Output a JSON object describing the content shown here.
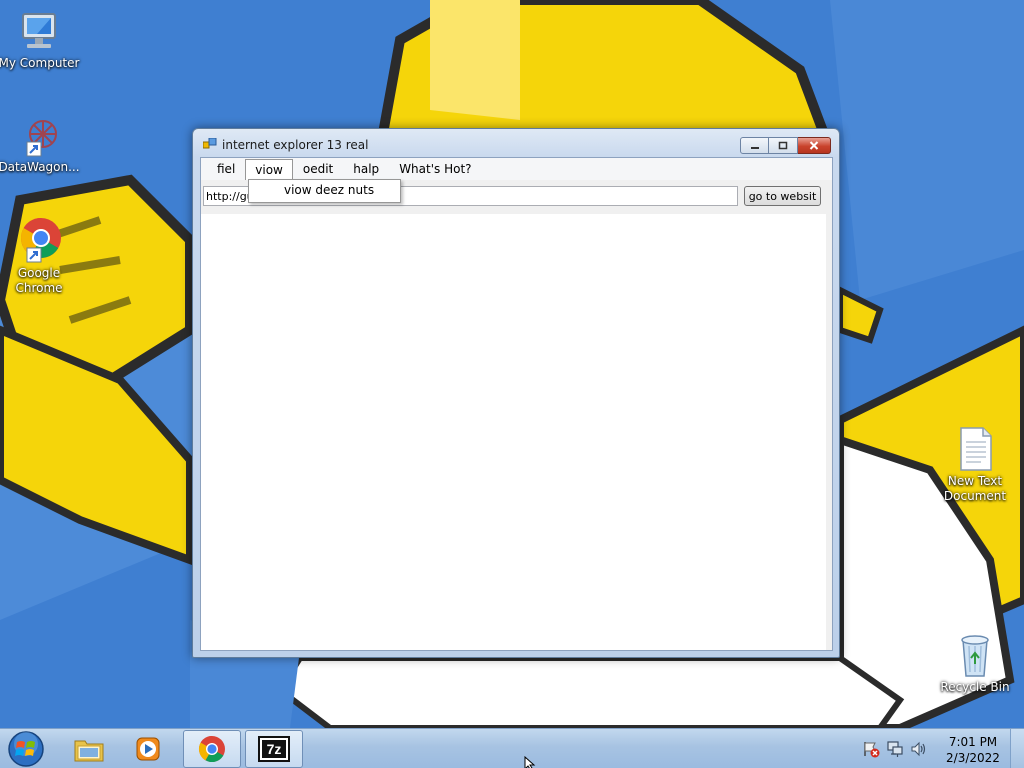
{
  "desktop": {
    "icons": [
      {
        "label": "My Computer",
        "icon": "computer-icon"
      },
      {
        "label": "DataWagon...",
        "icon": "datawagon-icon"
      },
      {
        "label": "Google Chrome",
        "icon": "chrome-icon"
      },
      {
        "label": "New Text Document",
        "icon": "text-document-icon"
      },
      {
        "label": "Recycle Bin",
        "icon": "recycle-bin-icon"
      }
    ]
  },
  "window": {
    "title": "internet explorer 13 real",
    "caption_buttons": {
      "minimize": "minimize-icon",
      "maximize": "maximize-icon",
      "close": "close-icon"
    },
    "menu": [
      {
        "label": "fiel"
      },
      {
        "label": "viow",
        "open": true
      },
      {
        "label": "oedit"
      },
      {
        "label": "halp"
      },
      {
        "label": "What's Hot?"
      }
    ],
    "dropdown": {
      "items": [
        "viow deez nuts"
      ]
    },
    "address": {
      "value": "http://gu"
    },
    "go_button": "go to websit"
  },
  "taskbar": {
    "buttons": [
      {
        "name": "file-explorer",
        "icon": "folder-icon"
      },
      {
        "name": "media-player",
        "icon": "media-player-icon"
      },
      {
        "name": "google-chrome",
        "icon": "chrome-icon",
        "active": true
      },
      {
        "name": "7-zip",
        "icon": "7zip-icon",
        "text": "7z"
      }
    ],
    "tray_icons": [
      "action-center-flag-icon",
      "network-icon",
      "volume-icon"
    ],
    "clock": {
      "time": "7:01 PM",
      "date": "2/3/2022"
    }
  },
  "colors": {
    "desktop_blue": "#3f7fd1",
    "wallpaper_yellow": "#f5d50a",
    "close_red": "#c9432d",
    "taskbar": "#a7c3e2"
  }
}
